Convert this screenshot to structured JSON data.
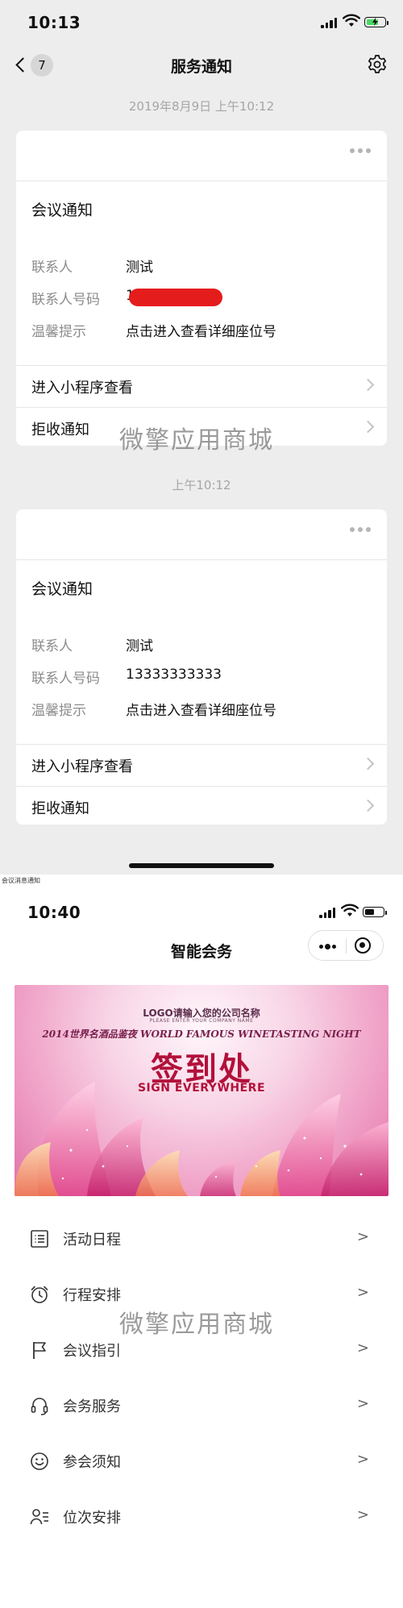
{
  "screen1": {
    "status_time": "10:13",
    "nav": {
      "back_count": "7",
      "title": "服务通知"
    },
    "messages": [
      {
        "timestamp": "2019年8月9日 上午10:12",
        "title": "会议通知",
        "fields": [
          {
            "label": "联系人",
            "value": "测试"
          },
          {
            "label": "联系人号码",
            "value": "1"
          },
          {
            "label": "温馨提示",
            "value": "点击进入查看详细座位号"
          }
        ],
        "actions": [
          {
            "label": "进入小程序查看"
          },
          {
            "label": "拒收通知"
          }
        ]
      },
      {
        "timestamp": "上午10:12",
        "title": "会议通知",
        "fields": [
          {
            "label": "联系人",
            "value": "测试"
          },
          {
            "label": "联系人号码",
            "value": "13333333333"
          },
          {
            "label": "温馨提示",
            "value": "点击进入查看详细座位号"
          }
        ],
        "actions": [
          {
            "label": "进入小程序查看"
          },
          {
            "label": "拒收通知"
          }
        ]
      }
    ]
  },
  "caption": "会议消息通知",
  "watermark": "微擎应用商城",
  "screen2": {
    "status_time": "10:40",
    "nav_title": "智能会务",
    "banner": {
      "logo_text": "LOGO请输入您的公司名称",
      "logo_sub": "PLEASE ENTER YOUR COMPANY NAME",
      "event_line": "2014世界名酒品鉴夜 WORLD FAMOUS WINETASTING NIGHT",
      "main_text": "签到处",
      "main_en": "SIGN EVERYWHERE"
    },
    "menu": [
      {
        "label": "活动日程",
        "icon": "list-icon",
        "arrow": ">"
      },
      {
        "label": "行程安排",
        "icon": "alarm-clock-icon",
        "arrow": ">"
      },
      {
        "label": "会议指引",
        "icon": "flag-icon",
        "arrow": ">"
      },
      {
        "label": "会务服务",
        "icon": "headset-icon",
        "arrow": ">"
      },
      {
        "label": "参会须知",
        "icon": "smiley-icon",
        "arrow": ">"
      },
      {
        "label": "位次安排",
        "icon": "seat-list-icon",
        "arrow": ">"
      }
    ]
  },
  "colors": {
    "chat_bg": "#ededed",
    "battery_charging": "#4cd964",
    "redaction": "#e51c1c",
    "banner_accent": "#b2103a"
  }
}
